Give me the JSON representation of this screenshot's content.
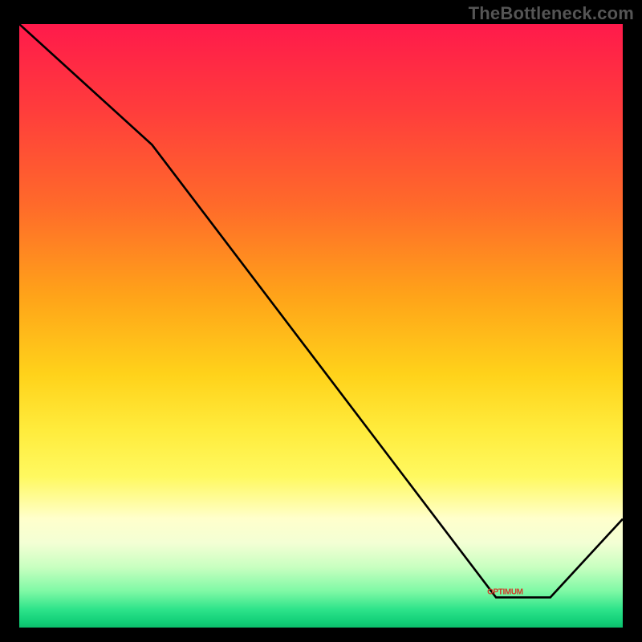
{
  "watermark": "TheBottleneck.com",
  "annotation_text": "OPTIMUM",
  "annotation_pos": {
    "x_pct": 80.5,
    "y_pct": 94.1
  },
  "chart_data": {
    "type": "line",
    "title": "",
    "xlabel": "",
    "ylabel": "",
    "xlim": [
      0,
      100
    ],
    "ylim": [
      0,
      100
    ],
    "series": [
      {
        "name": "curve",
        "x": [
          0,
          22,
          79,
          88,
          100
        ],
        "y": [
          100,
          80,
          5,
          5,
          18
        ]
      }
    ],
    "optimum_segment": {
      "x_start": 76,
      "x_end": 88,
      "y": 5
    }
  }
}
